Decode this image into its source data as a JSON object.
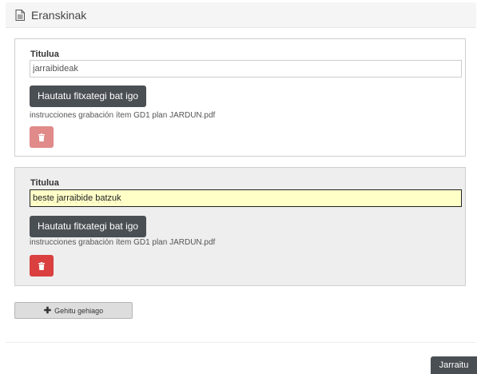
{
  "panel": {
    "title": "Eranskinak"
  },
  "items": [
    {
      "label": "Titulua",
      "value": "jarraibideak",
      "upload_label": "Hautatu fitxategi bat igo",
      "filename": "instrucciones grabación ítem GD1 plan JARDUN.pdf"
    },
    {
      "label": "Titulua",
      "value": "beste jarraibide batzuk",
      "upload_label": "Hautatu fitxategi bat igo",
      "filename": "instrucciones grabación ítem GD1 plan JARDUN.pdf"
    }
  ],
  "actions": {
    "add_more": "Gehitu gehiago",
    "continue": "Jarraitu"
  },
  "colors": {
    "dark_button": "#4a4f54",
    "danger": "#d9403f",
    "danger_disabled": "#e08a8a",
    "focused_input_bg": "#ffffc8"
  }
}
